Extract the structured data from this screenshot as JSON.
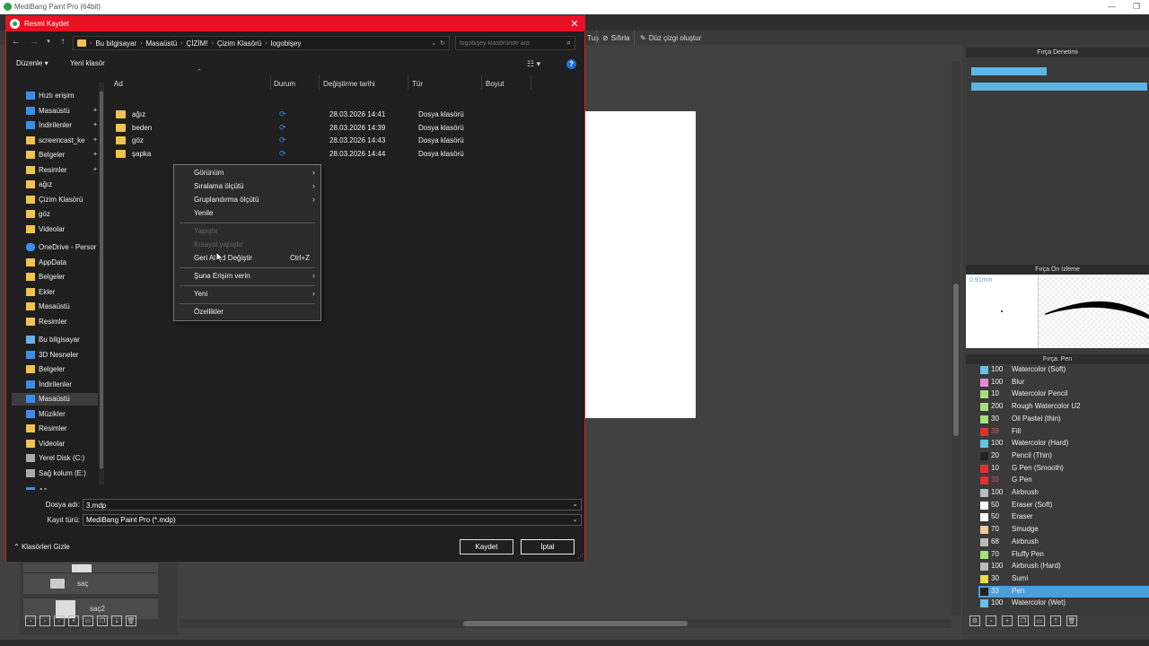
{
  "app": {
    "title": "MediBang Paint Pro (64bit)",
    "toolbar": {
      "reset_label": "Sıfırla",
      "straight_line_label": "Düz çizgi oluştur",
      "truncated_label": "Tuş"
    }
  },
  "layers": {
    "items": [
      {
        "label": "saç"
      },
      {
        "label": "saç2"
      }
    ]
  },
  "panels": {
    "brush_control_title": "Fırça Denetimi",
    "brush_preview_title": "Fırça Ön İzleme",
    "brush_preview_size": "0.91mm",
    "brush_list_title": "Fırça: Pen",
    "brushes": [
      {
        "size": "100",
        "name": "Watercolor (Soft)",
        "color": "#66c2e6"
      },
      {
        "size": "100",
        "name": "Blur",
        "color": "#e68ad6"
      },
      {
        "size": "10",
        "name": "Watercolor Pencil",
        "color": "#a6e07a"
      },
      {
        "size": "200",
        "name": "Rough Watercolor U2",
        "color": "#a6e07a"
      },
      {
        "size": "30",
        "name": "Oil Pastel (thin)",
        "color": "#a6e07a"
      },
      {
        "size": "38",
        "name": "Fill",
        "color": "#e03030"
      },
      {
        "size": "100",
        "name": "Watercolor (Hard)",
        "color": "#66c2e6"
      },
      {
        "size": "20",
        "name": "Pencil (Thin)",
        "color": "#222222"
      },
      {
        "size": "10",
        "name": "G Pen (Smooth)",
        "color": "#e03030"
      },
      {
        "size": "33",
        "name": "G Pen",
        "color": "#e03030"
      },
      {
        "size": "100",
        "name": "Airbrush",
        "color": "#bbbbbb"
      },
      {
        "size": "50",
        "name": "Eraser (Soft)",
        "color": "#ffffff"
      },
      {
        "size": "50",
        "name": "Eraser",
        "color": "#ffffff"
      },
      {
        "size": "70",
        "name": "Smudge",
        "color": "#f0c8a0"
      },
      {
        "size": "68",
        "name": "Airbrush",
        "color": "#bbbbbb"
      },
      {
        "size": "70",
        "name": "Fluffy Pen",
        "color": "#a6e07a"
      },
      {
        "size": "100",
        "name": "Airbrush (Hard)",
        "color": "#bbbbbb"
      },
      {
        "size": "30",
        "name": "Sumi",
        "color": "#e6e040"
      },
      {
        "size": "33",
        "name": "Pen",
        "color": "#222222",
        "selected": true
      },
      {
        "size": "100",
        "name": "Watercolor (Wet)",
        "color": "#66c2e6"
      }
    ]
  },
  "dialog": {
    "title": "Resmi Kaydet",
    "breadcrumb": [
      "Bu bilgisayar",
      "Masaüstü",
      "ÇİZİM!",
      "Çizim Klasörü",
      "logobişey"
    ],
    "search_placeholder": "logobişey klasöründe ara",
    "organize_label": "Düzenle",
    "new_folder_label": "Yeni klasör",
    "columns": {
      "name": "Ad",
      "status": "Durum",
      "modified": "Değiştirme tarihi",
      "type": "Tür",
      "size": "Boyut"
    },
    "files": [
      {
        "name": "ağız",
        "date": "28.03.2026 14:41",
        "type": "Dosya klasörü"
      },
      {
        "name": "beden",
        "date": "28.03.2026 14:39",
        "type": "Dosya klasörü"
      },
      {
        "name": "göz",
        "date": "28.03.2026 14:43",
        "type": "Dosya klasörü"
      },
      {
        "name": "şapka",
        "date": "28.03.2026 14:44",
        "type": "Dosya klasörü"
      }
    ],
    "nav": {
      "quick_access": "Hızlı erişim",
      "quick_items": [
        "Masaüstü",
        "İndirilenler",
        "screencast_ke",
        "Belgeler",
        "Resimler",
        "ağız",
        "Çizim Klasörü",
        "göz",
        "Videolar"
      ],
      "onedrive": "OneDrive - Persor",
      "onedrive_items": [
        "AppData",
        "Belgeler",
        "Ekler",
        "Masaüstü",
        "Resimler"
      ],
      "this_pc": "Bu bilgisayar",
      "pc_items": [
        "3D Nesneler",
        "Belgeler",
        "İndirilenler",
        "Masaüstü",
        "Müzikler",
        "Resimler",
        "Videolar",
        "Yerel Disk (C:)",
        "Sağ kolum (E:)"
      ],
      "more": "Ağ"
    },
    "context_menu": {
      "view": "Görünüm",
      "sort_by": "Sıralama ölçütü",
      "group_by": "Gruplandırma ölçütü",
      "refresh": "Yenile",
      "paste": "Yapıştır",
      "paste_shortcut": "Kısayol yapıştır",
      "undo": "Geri Al Ad Değiştir",
      "undo_shortcut": "Ctrl+Z",
      "give_access": "Şuna Erişim verin",
      "new": "Yeni",
      "properties": "Özellikler"
    },
    "filename_label": "Dosya adı:",
    "filename_value": "3.mdp",
    "filetype_label": "Kayıt türü:",
    "filetype_value": "MediBang Paint Pro (*.mdp)",
    "hide_folders_label": "Klasörleri Gizle",
    "save_label": "Kaydet",
    "cancel_label": "İptal"
  }
}
